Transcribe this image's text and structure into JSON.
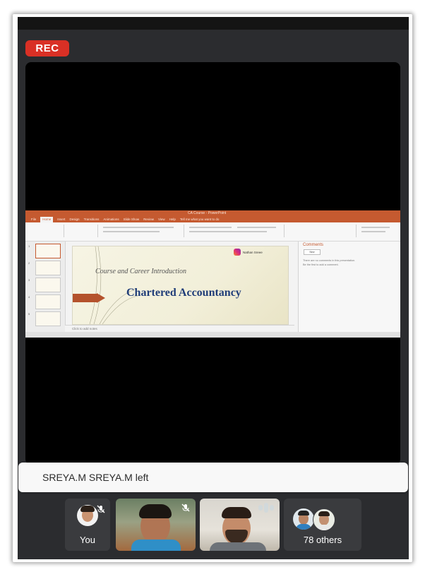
{
  "meeting": {
    "rec_label": "REC"
  },
  "shared_screen": {
    "app_title": "CA Course - PowerPoint",
    "ribbon_tabs": [
      "File",
      "Home",
      "Insert",
      "Design",
      "Transitions",
      "Animations",
      "Slide Show",
      "Review",
      "View",
      "Help",
      "Tell me what you want to do"
    ],
    "active_tab": "Home",
    "slide": {
      "subtitle": "Course and Career Introduction",
      "title": "Chartered Accountancy",
      "brand": "Nathan Sreee"
    },
    "notes_placeholder": "Click to add notes",
    "comments": {
      "header": "Comments",
      "new_button": "New",
      "empty_text_1": "There are no comments in this presentation.",
      "empty_text_2": "Be the first to add a comment."
    }
  },
  "notification": {
    "text": "SREYA.M SREYA.M left"
  },
  "participants": {
    "you_label": "You",
    "others_label": "78 others"
  },
  "colors": {
    "rec": "#d93025",
    "app_bg": "#2b2c2f",
    "ppt_accent": "#c55a30",
    "slide_title": "#1f3c78"
  }
}
